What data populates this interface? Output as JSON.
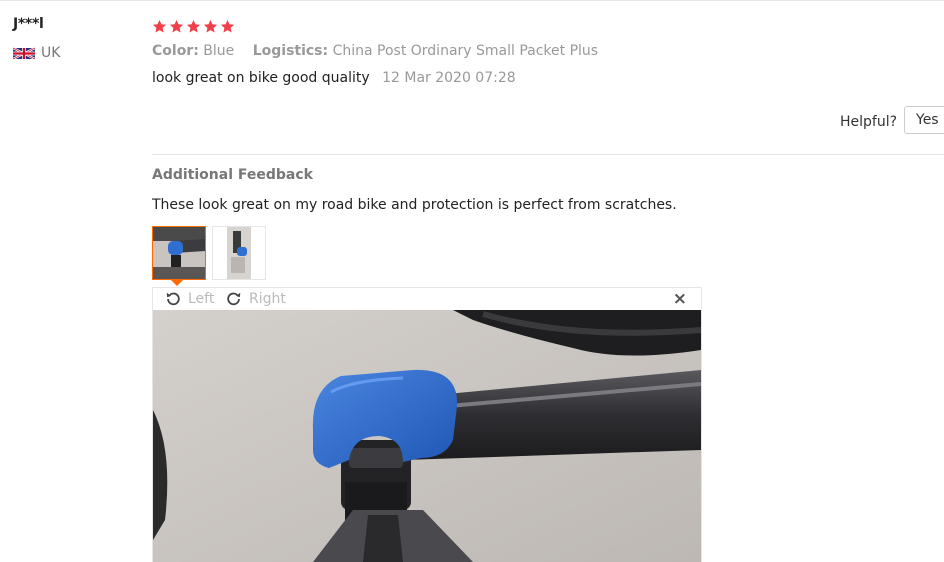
{
  "reviewer": {
    "name": "J***l",
    "country": "UK",
    "flag_icon": "uk-flag-icon"
  },
  "rating": {
    "stars": 5,
    "max": 5,
    "color": "#f0404a"
  },
  "meta": {
    "color_label": "Color:",
    "color_value": "Blue",
    "logistics_label": "Logistics:",
    "logistics_value": "China Post Ordinary Small Packet Plus"
  },
  "review": {
    "text": "look great on bike good quality",
    "date": "12 Mar 2020 07:28"
  },
  "helpful": {
    "label": "Helpful?",
    "yes_label": "Yes ("
  },
  "additional": {
    "title": "Additional Feedback",
    "text": "These look great on my road bike and protection is perfect from scratches."
  },
  "viewer": {
    "rotate_left_label": "Left",
    "rotate_right_label": "Right",
    "close_label": "×"
  },
  "colors": {
    "accent": "#ff6a00",
    "star": "#f0404a",
    "muted": "#999999"
  }
}
